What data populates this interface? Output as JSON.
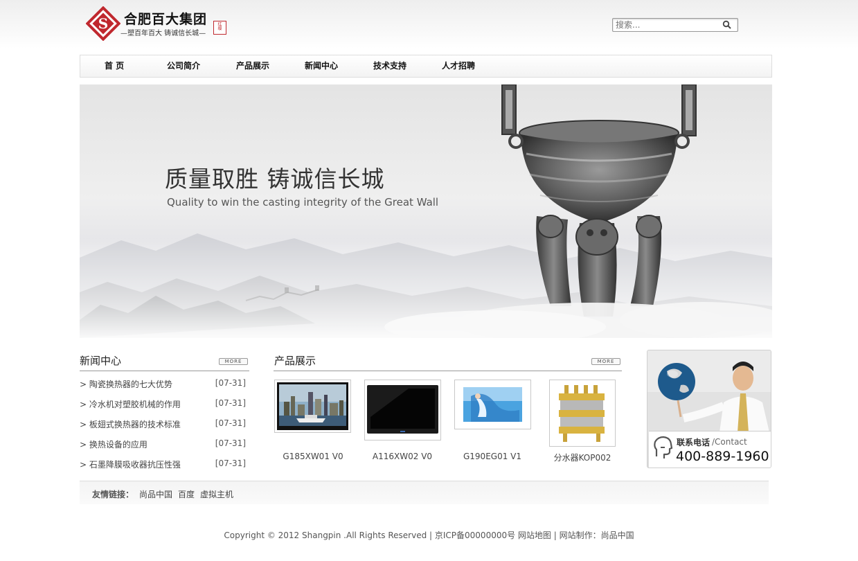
{
  "header": {
    "company_name": "合肥百大集团",
    "slogan": "—塑百年百大 铸诚信长城—",
    "seal_text": "红缨",
    "search_placeholder": "搜索..."
  },
  "nav": {
    "items": [
      "首 页",
      "公司简介",
      "产品展示",
      "新闻中心",
      "技术支持",
      "人才招聘"
    ]
  },
  "banner": {
    "headline": "质量取胜  铸诚信长城",
    "subline": "Quality to win the casting integrity of the Great Wall"
  },
  "news": {
    "title": "新闻中心",
    "more_label": "MORE",
    "items": [
      {
        "title": "> 陶瓷换热器的七大优势",
        "date": "[07-31]"
      },
      {
        "title": "> 冷水机对塑胶机械的作用",
        "date": "[07-31]"
      },
      {
        "title": "> 板翅式换热器的技术标准",
        "date": "[07-31]"
      },
      {
        "title": "> 换热设备的应用",
        "date": "[07-31]"
      },
      {
        "title": "> 石墨降膜吸收器抗压性强",
        "date": "[07-31]"
      }
    ]
  },
  "products": {
    "title": "产品展示",
    "more_label": "MORE",
    "items": [
      {
        "name": "G185XW01 V0",
        "icon": "city-skyline-tv-image"
      },
      {
        "name": "A116XW02 V0",
        "icon": "black-tv-image"
      },
      {
        "name": "G190EG01 V1",
        "icon": "blue-dancer-image"
      },
      {
        "name": "分水器KOP002",
        "icon": "water-distributor-image"
      }
    ]
  },
  "contact": {
    "label": "联系电话",
    "label_en": "/Contact",
    "phone": "400-889-1960"
  },
  "links": {
    "label": "友情链接：",
    "items": [
      "尚品中国",
      "百度",
      "虚拟主机"
    ]
  },
  "footer": {
    "text": "Copyright © 2012 Shangpin .All Rights Reserved | 京ICP备00000000号 网站地图 | 网站制作：尚品中国"
  },
  "colors": {
    "brand_red": "#c0282e",
    "text_dark": "#222222",
    "border": "#dddddd"
  }
}
